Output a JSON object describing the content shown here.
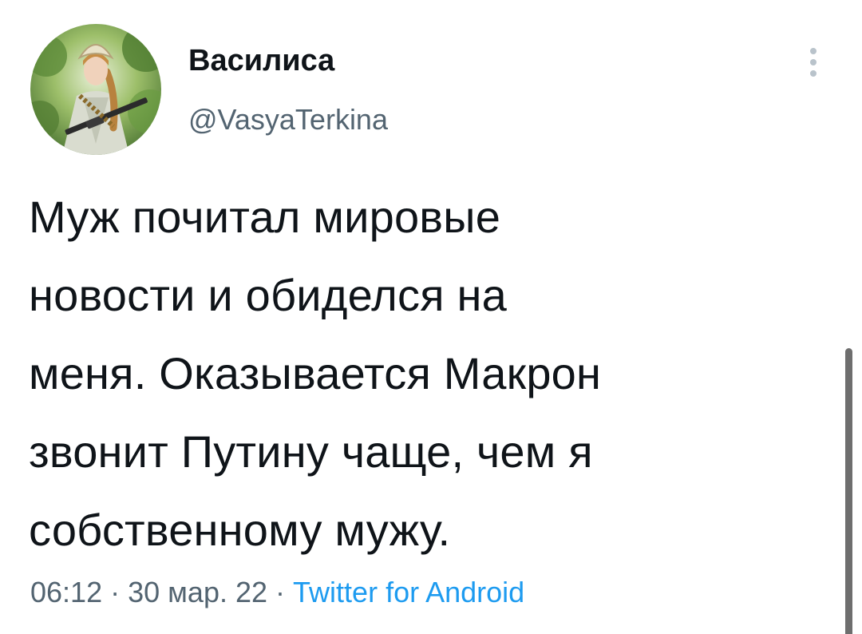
{
  "tweet": {
    "author": {
      "display_name": "Василиса",
      "handle": "@VasyaTerkina"
    },
    "text": "Муж почитал мировые\nновости и обиделся на\nменя. Оказывается Макрон\nзвонит Путину чаще, чем я\nсобственному мужу.",
    "time": "06:12",
    "separator": "·",
    "date": "30 мар. 22",
    "source": "Twitter for Android"
  },
  "colors": {
    "text_primary": "#0f1419",
    "text_secondary": "#536471",
    "link": "#1d9bf0",
    "scrollbar": "#6e6e6e"
  },
  "icons": {
    "more": "vertical-ellipsis-icon"
  }
}
